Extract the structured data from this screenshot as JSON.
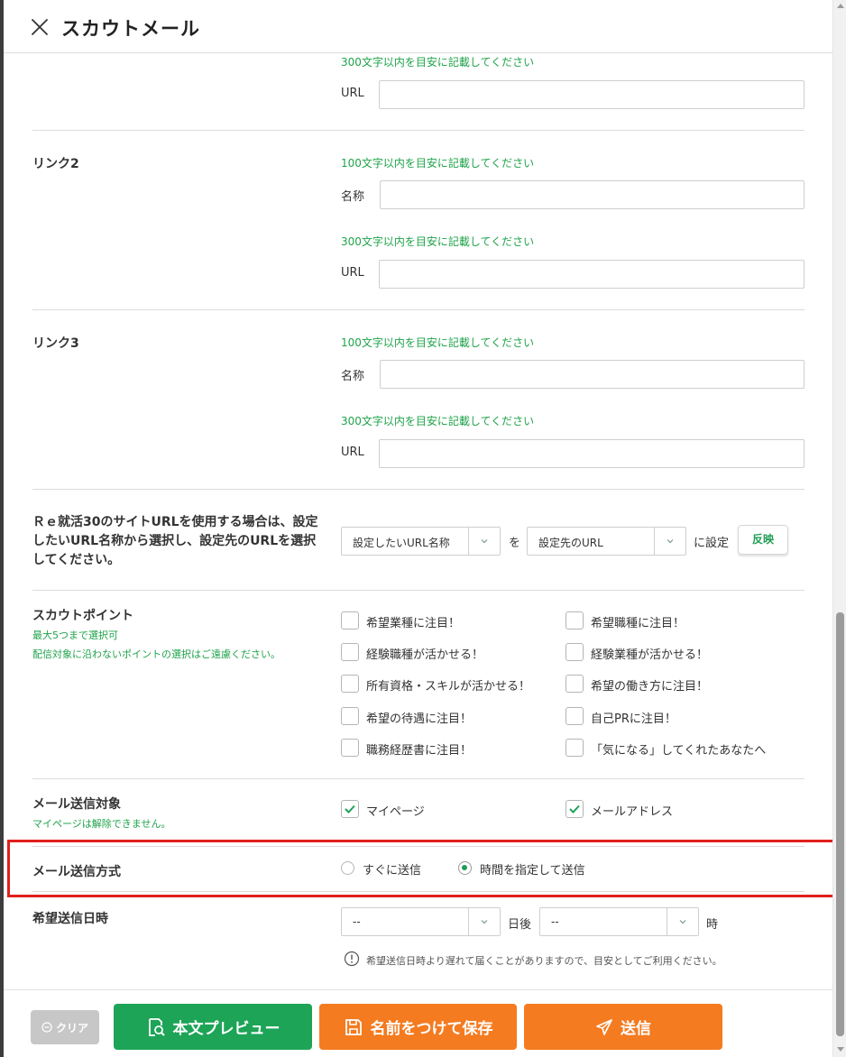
{
  "header": {
    "title": "スカウトメール"
  },
  "link1": {
    "url_hint": "300文字以内を目安に記載してください",
    "url_label": "URL"
  },
  "link2": {
    "title": "リンク2",
    "name_hint": "100文字以内を目安に記載してください",
    "name_label": "名称",
    "url_hint": "300文字以内を目安に記載してください",
    "url_label": "URL"
  },
  "link3": {
    "title": "リンク3",
    "name_hint": "100文字以内を目安に記載してください",
    "name_label": "名称",
    "url_hint": "300文字以内を目安に記載してください",
    "url_label": "URL"
  },
  "site_url": {
    "description_lines": [
      "Ｒｅ就活30のサイトURLを使用する場合は、設定",
      "したいURL名称から選択し、設定先のURLを選択",
      "してください。"
    ],
    "name_select": "設定したいURL名称",
    "connector": "を",
    "target_select": "設定先のURL",
    "suffix": "に設定",
    "reflect_button": "反映"
  },
  "scout_points": {
    "title": "スカウトポイント",
    "hint1": "最大5つまで選択可",
    "hint2": "配信対象に沿わないポイントの選択はご遠慮ください。",
    "items": [
      {
        "label": "希望業種に注目！",
        "checked": false
      },
      {
        "label": "希望職種に注目！",
        "checked": false
      },
      {
        "label": "経験職種が活かせる！",
        "checked": false
      },
      {
        "label": "経験業種が活かせる！",
        "checked": false
      },
      {
        "label": "所有資格・スキルが活かせる！",
        "checked": false
      },
      {
        "label": "希望の働き方に注目！",
        "checked": false
      },
      {
        "label": "希望の待遇に注目！",
        "checked": false
      },
      {
        "label": "自己PRに注目！",
        "checked": false
      },
      {
        "label": "職務経歴書に注目！",
        "checked": false
      },
      {
        "label": "「気になる」してくれたあなたへ",
        "checked": false
      }
    ]
  },
  "mail_target": {
    "title": "メール送信対象",
    "hint": "マイページは解除できません。",
    "options": [
      {
        "label": "マイページ",
        "checked": true
      },
      {
        "label": "メールアドレス",
        "checked": true
      }
    ]
  },
  "send_method": {
    "title": "メール送信方式",
    "options": [
      {
        "label": "すぐに送信",
        "selected": false
      },
      {
        "label": "時間を指定して送信",
        "selected": true
      }
    ]
  },
  "send_datetime": {
    "title": "希望送信日時",
    "days_value": "--",
    "days_suffix": "日後",
    "hour_value": "--",
    "hour_suffix": "時",
    "note": "希望送信日時より遅れて届くことがありますので、目安としてご利用ください。"
  },
  "footer": {
    "clear": "クリア",
    "preview": "本文プレビュー",
    "save": "名前をつけて保存",
    "send": "送信"
  },
  "colors": {
    "green": "#1da457",
    "orange": "#f47b20",
    "highlight": "#e0201c",
    "hint_green": "#1fa34a"
  }
}
